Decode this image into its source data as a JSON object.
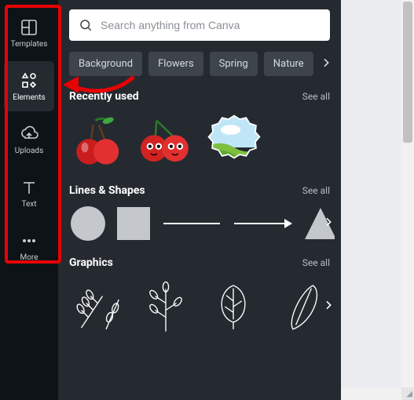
{
  "sidebar": {
    "items": [
      {
        "label": "Templates"
      },
      {
        "label": "Elements"
      },
      {
        "label": "Uploads"
      },
      {
        "label": "Text"
      },
      {
        "label": "More"
      }
    ]
  },
  "search": {
    "placeholder": "Search anything from Canva",
    "value": ""
  },
  "chips": {
    "items": [
      "Background",
      "Flowers",
      "Spring",
      "Nature"
    ]
  },
  "sections": {
    "recent": {
      "title": "Recently used",
      "see_all": "See all"
    },
    "shapes": {
      "title": "Lines & Shapes",
      "see_all": "See all"
    },
    "graphics": {
      "title": "Graphics",
      "see_all": "See all"
    }
  },
  "colors": {
    "highlight": "#e80204",
    "panel_bg": "#252a31",
    "sidebar_bg": "#0e1318"
  },
  "annotation": {
    "highlight_target": "sidebar",
    "arrow_points_to": "elements-tab"
  }
}
